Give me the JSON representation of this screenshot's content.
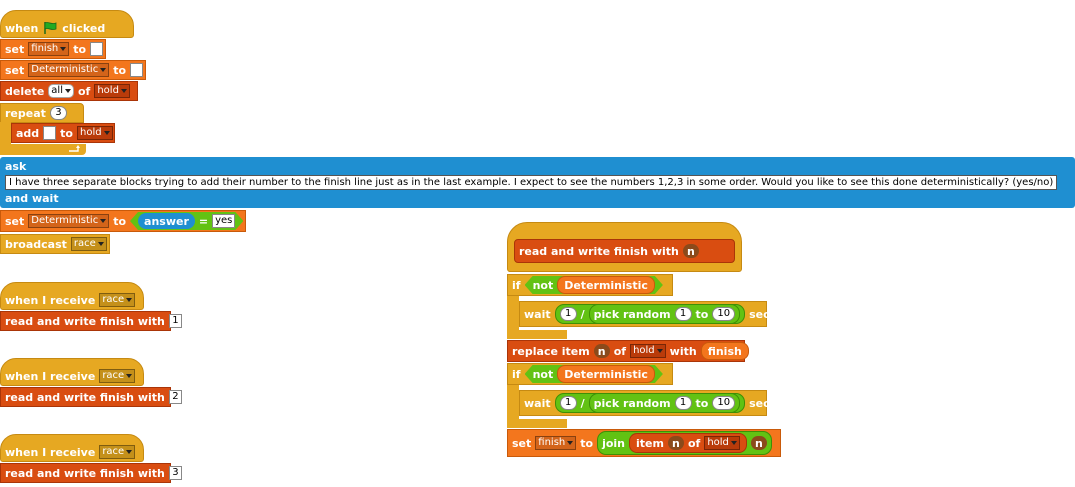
{
  "main_script": {
    "hat_prefix": "when",
    "hat_suffix": "clicked",
    "set1": {
      "label": "set",
      "var": "finish",
      "to": "to",
      "value": ""
    },
    "set2": {
      "label": "set",
      "var": "Deterministic",
      "to": "to",
      "value": ""
    },
    "delete": {
      "label": "delete",
      "which": "all",
      "of": "of",
      "list": "hold"
    },
    "repeat": {
      "label": "repeat",
      "count": "3"
    },
    "add": {
      "label": "add",
      "value": "",
      "to": "to",
      "list": "hold"
    },
    "ask": {
      "label": "ask",
      "question": "I have three separate blocks trying to add their number to the finish line just as in the last example. I expect to see the numbers 1,2,3 in some order. Would you like to see this done deterministically? (yes/no)",
      "suffix": "and wait"
    },
    "set3": {
      "label": "set",
      "var": "Deterministic",
      "to": "to",
      "lhs": "answer",
      "eq": "=",
      "rhs": "yes"
    },
    "broadcast": {
      "label": "broadcast",
      "msg": "race"
    }
  },
  "receivers": [
    {
      "hat": "when I receive",
      "msg": "race",
      "call": "read and write finish with",
      "arg": "1"
    },
    {
      "hat": "when I receive",
      "msg": "race",
      "call": "read and write finish with",
      "arg": "2"
    },
    {
      "hat": "when I receive",
      "msg": "race",
      "call": "read and write finish with",
      "arg": "3"
    }
  ],
  "definition": {
    "proto": "read and write finish with",
    "param": "n",
    "if1": {
      "if": "if",
      "not": "not",
      "cond": "Deterministic",
      "wait": "wait",
      "num": "1",
      "div": "/",
      "pick": "pick random",
      "from": "1",
      "to": "to",
      "to_val": "10",
      "secs": "secs"
    },
    "replace": {
      "label": "replace item",
      "n": "n",
      "of": "of",
      "list": "hold",
      "with": "with",
      "value": "finish"
    },
    "if2": {
      "if": "if",
      "not": "not",
      "cond": "Deterministic",
      "wait": "wait",
      "num": "1",
      "div": "/",
      "pick": "pick random",
      "from": "1",
      "to": "to",
      "to_val": "10",
      "secs": "secs"
    },
    "set": {
      "label": "set",
      "var": "finish",
      "to": "to",
      "join": "join",
      "item": "item",
      "n": "n",
      "of": "of",
      "list": "hold",
      "n2": "n"
    }
  },
  "colors": {
    "events": "#e6a822",
    "variables": "#f3761d",
    "lists": "#d94d11",
    "sensing": "#1f8fd1",
    "operators": "#62c213",
    "flag": "#22aa22"
  }
}
